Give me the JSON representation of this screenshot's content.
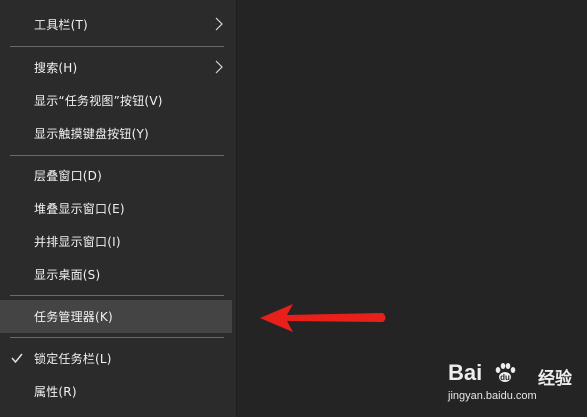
{
  "menu": {
    "items": [
      {
        "label": "工具栏(T)",
        "submenu": true
      },
      {
        "label": "搜索(H)",
        "submenu": true
      },
      {
        "label": "显示“任务视图”按钮(V)"
      },
      {
        "label": "显示触摸键盘按钮(Y)"
      },
      {
        "label": "层叠窗口(D)"
      },
      {
        "label": "堆叠显示窗口(E)"
      },
      {
        "label": "并排显示窗口(I)"
      },
      {
        "label": "显示桌面(S)"
      },
      {
        "label": "任务管理器(K)",
        "highlighted": true
      },
      {
        "label": "锁定任务栏(L)",
        "checked": true
      },
      {
        "label": "属性(R)"
      }
    ]
  },
  "annotation": {
    "arrow_color": "#e8201c",
    "points_to": "任务管理器(K)"
  },
  "watermark": {
    "brand_left": "Bai",
    "brand_right": "经验",
    "url": "jingyan.baidu.com"
  },
  "colors": {
    "menu_bg": "#2b2b2b",
    "desktop_bg": "#242424",
    "highlight": "#444444",
    "text": "#f2f2f2",
    "separator": "#6a6a6a"
  },
  "icons": {
    "submenu": "chevron-right-icon",
    "checked": "checkmark-icon",
    "watermark": "baidu-paw-icon"
  }
}
